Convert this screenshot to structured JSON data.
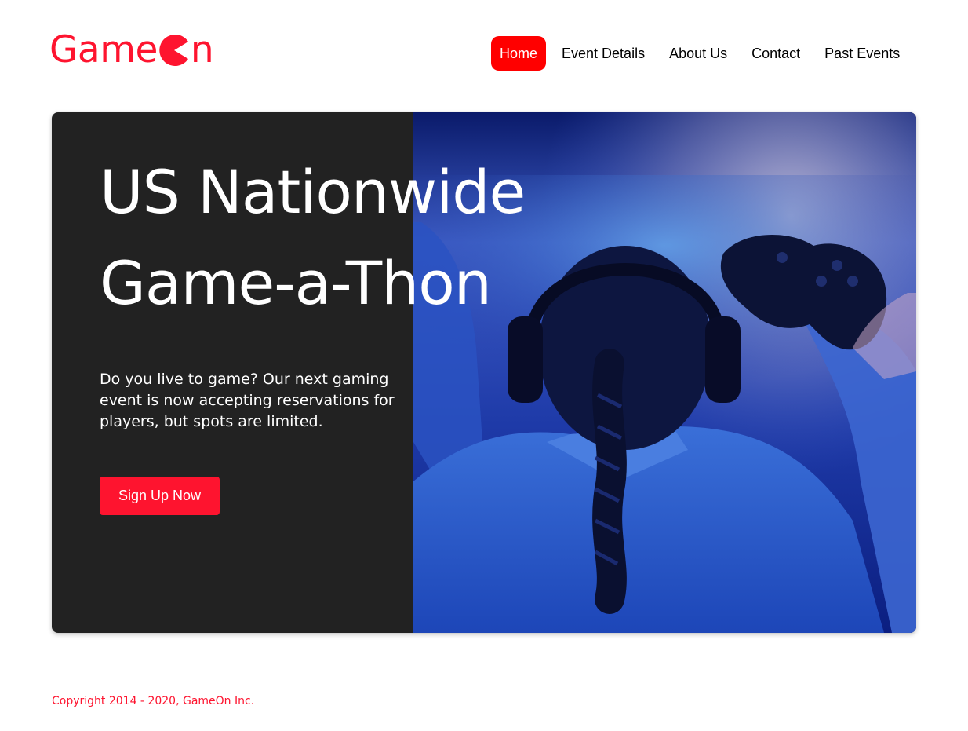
{
  "brand": {
    "name_part1": "Game",
    "name_part2": "n",
    "color": "#fe142f"
  },
  "nav": {
    "items": [
      {
        "label": "Home",
        "active": true
      },
      {
        "label": "Event Details",
        "active": false
      },
      {
        "label": "About Us",
        "active": false
      },
      {
        "label": "Contact",
        "active": false
      },
      {
        "label": "Past Events",
        "active": false
      }
    ],
    "active_color": "#ff0000"
  },
  "hero": {
    "title_line1": "US Nationwide",
    "title_line2": "Game-a-Thon",
    "description": "Do you live to game? Our next gaming event is now accepting reservations for players, but spots are limited.",
    "cta_label": "Sign Up Now",
    "panel_color": "#222222",
    "photo_icon": "gamer-with-headphones-and-controller-image"
  },
  "footer": {
    "copyright": "Copyright 2014 - 2020, GameOn Inc."
  }
}
